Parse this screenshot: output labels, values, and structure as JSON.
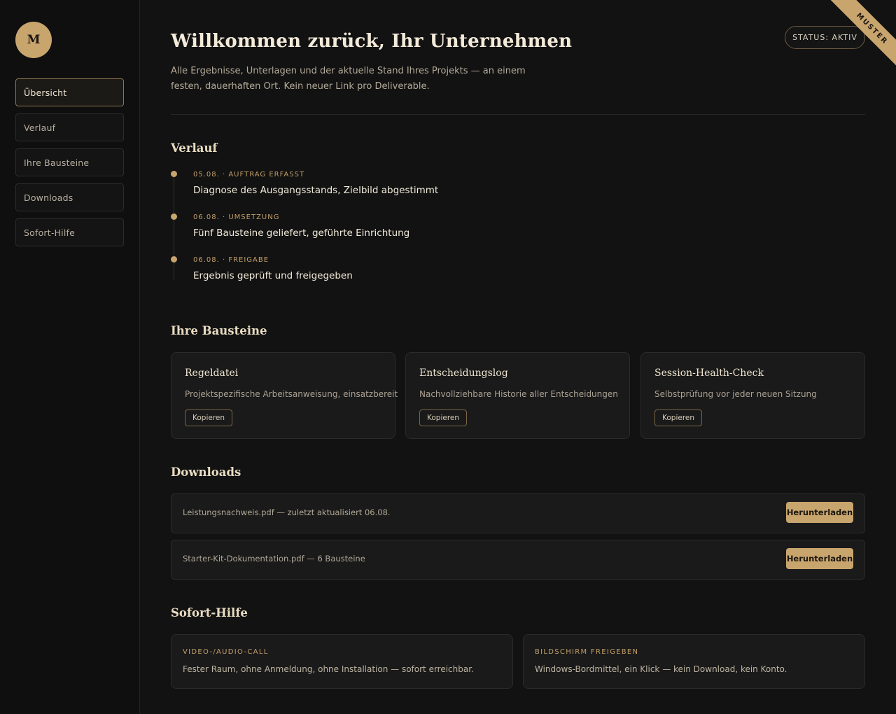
{
  "brand": {
    "logo_letter": "M"
  },
  "nav": {
    "items": [
      {
        "label": "Übersicht",
        "active": true
      },
      {
        "label": "Verlauf"
      },
      {
        "label": "Ihre Bausteine"
      },
      {
        "label": "Downloads"
      },
      {
        "label": "Sofort-Hilfe"
      }
    ]
  },
  "header": {
    "title": "Willkommen zurück, Ihr Unternehmen",
    "intro": "Alle Ergebnisse, Unterlagen und der aktuelle Stand Ihres Projekts — an einem festen, dauerhaften Ort. Kein neuer Link pro Deliverable.",
    "status": "STATUS: AKTIV",
    "ribbon": "MUSTER"
  },
  "timeline": {
    "title": "Verlauf",
    "items": [
      {
        "meta": "05.08. · AUFTRAG ERFASST",
        "text": "Diagnose des Ausgangsstands, Zielbild abgestimmt"
      },
      {
        "meta": "06.08. · UMSETZUNG",
        "text": "Fünf Bausteine geliefert, geführte Einrichtung"
      },
      {
        "meta": "06.08. · FREIGABE",
        "text": "Ergebnis geprüft und freigegeben"
      }
    ]
  },
  "bausteine": {
    "title": "Ihre Bausteine",
    "cards": [
      {
        "title": "Regeldatei",
        "desc": "Projektspezifische Arbeitsanweisung, einsatzbereit",
        "button": "Kopieren"
      },
      {
        "title": "Entscheidungslog",
        "desc": "Nachvollziehbare Historie aller Entscheidungen",
        "button": "Kopieren"
      },
      {
        "title": "Session-Health-Check",
        "desc": "Selbstprüfung vor jeder neuen Sitzung",
        "button": "Kopieren"
      }
    ]
  },
  "downloads": {
    "title": "Downloads",
    "items": [
      {
        "text": "Leistungsnachweis.pdf — zuletzt aktualisiert 06.08.",
        "button": "Herunterladen"
      },
      {
        "text": "Starter-Kit-Dokumentation.pdf — 6 Bausteine",
        "button": "Herunterladen"
      }
    ]
  },
  "hilfe": {
    "title": "Sofort-Hilfe",
    "items": [
      {
        "label": "VIDEO-/AUDIO-CALL",
        "text": "Fester Raum, ohne Anmeldung, ohne Installation — sofort erreichbar."
      },
      {
        "label": "BILDSCHIRM FREIGEBEN",
        "text": "Windows-Bordmittel, ein Klick — kein Download, kein Konto."
      }
    ]
  },
  "colors": {
    "accent": "#c9a56e",
    "background": "#121212",
    "card": "#1a1a1a"
  }
}
